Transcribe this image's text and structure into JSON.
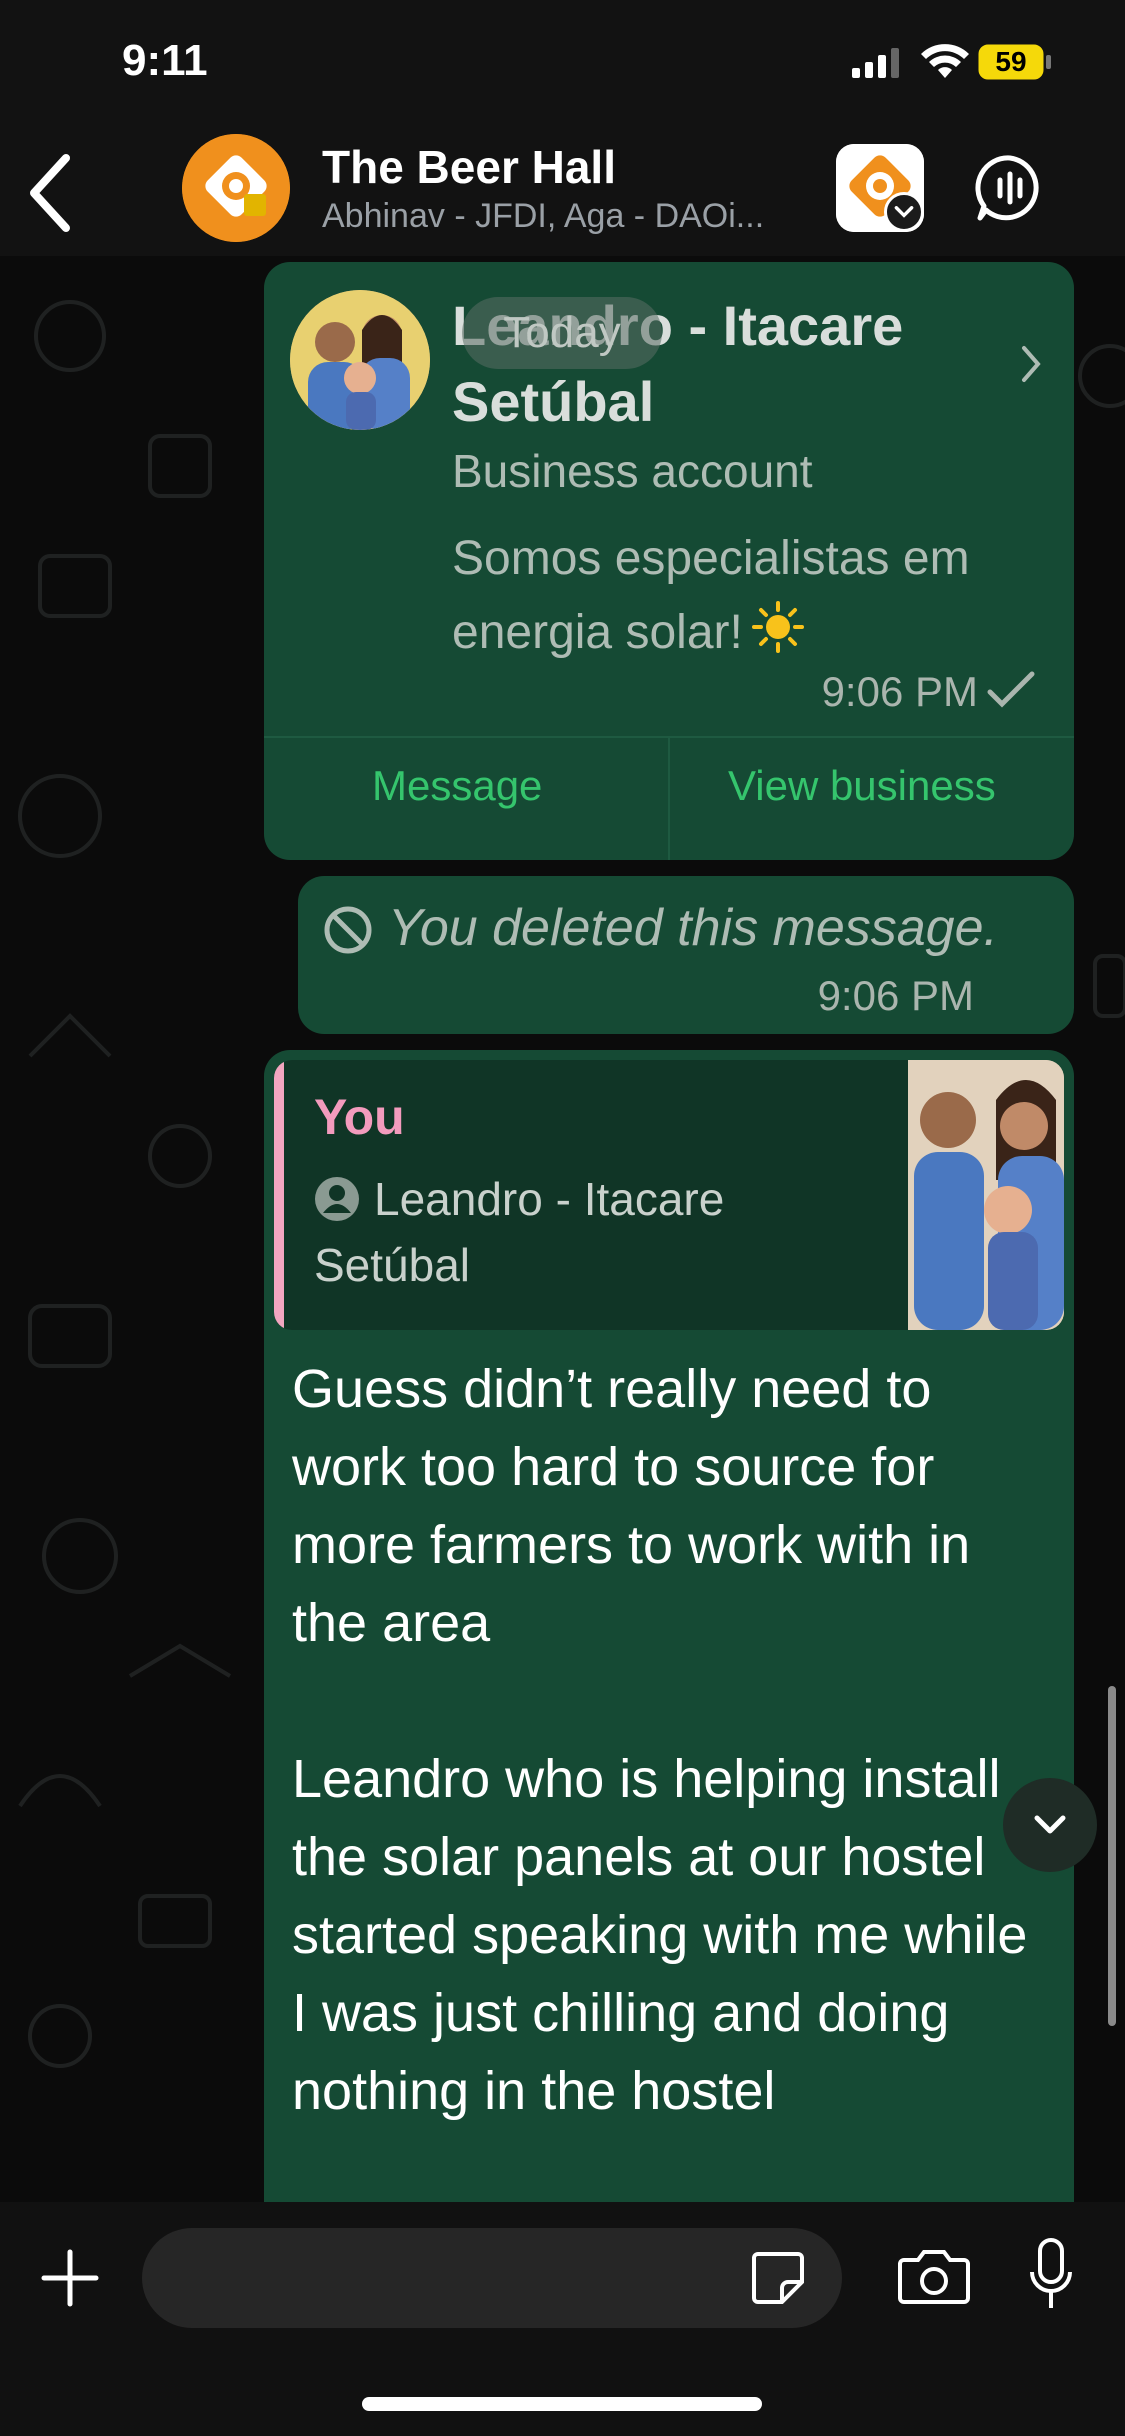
{
  "status_bar": {
    "time": "9:11",
    "battery": "59"
  },
  "header": {
    "title": "The Beer Hall",
    "subtitle": "Abhinav - JFDI, Aga - DAOi..."
  },
  "chat": {
    "date_pill": "Today",
    "contact_card": {
      "name": "Leandro - Itacare Setúbal",
      "type": "Business account",
      "description": "Somos especialistas em energia solar!",
      "time": "9:06 PM",
      "message_button": "Message",
      "view_business_button": "View business"
    },
    "deleted_message": {
      "text": "You deleted this message.",
      "time": "9:06 PM"
    },
    "reply_message": {
      "quote_author": "You",
      "quote_text": "Leandro - Itacare Setúbal",
      "body": "Guess didn’t really need to work too hard to source for more farmers to work with in the area\n\nLeandro who is helping install the solar panels at our hostel started speaking with me while I was just chilling and doing nothing in the hostel"
    }
  },
  "input": {
    "placeholder": ""
  },
  "colors": {
    "bubble": "#154a34",
    "quote_bg": "#103526",
    "accent_green": "#35c56d",
    "quote_author_pink": "#f39bbd",
    "background": "#0b0b0b"
  },
  "icons": [
    "back-chevron-icon",
    "group-avatar-icon",
    "community-icon",
    "voice-chat-icon",
    "chevron-right-icon",
    "sun-emoji-icon",
    "check-icon",
    "blocked-icon",
    "person-icon",
    "chevron-down-icon",
    "plus-icon",
    "sticker-icon",
    "camera-icon",
    "microphone-icon"
  ]
}
